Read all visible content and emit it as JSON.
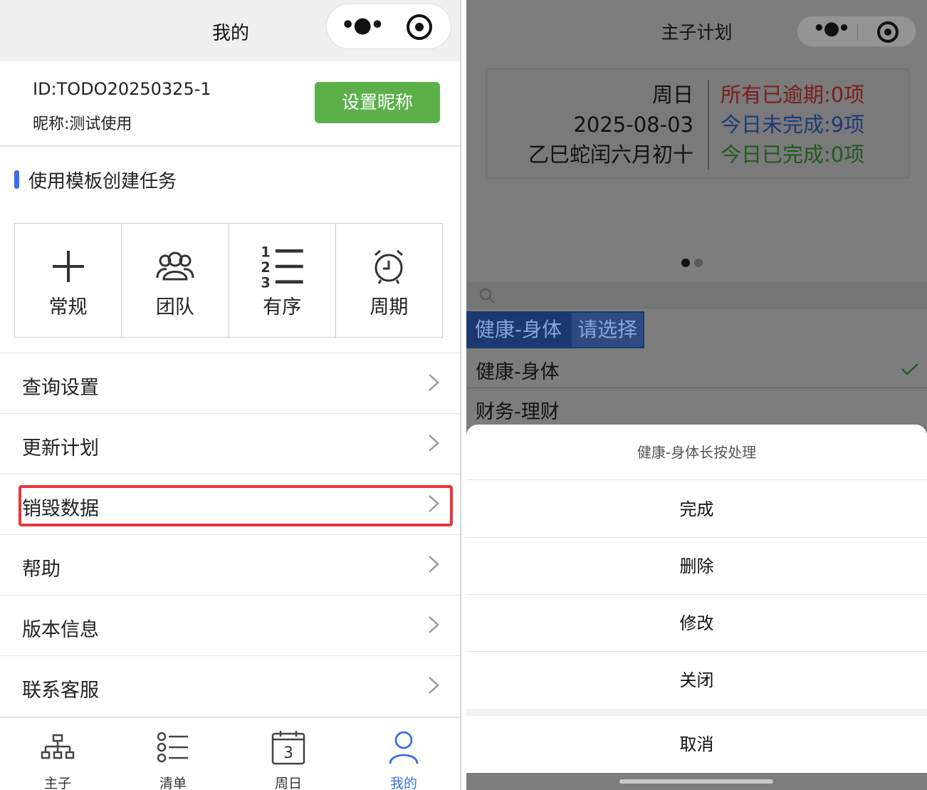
{
  "left": {
    "nav_title": "我的",
    "profile": {
      "uid": "ID:TODO20250325-1",
      "nickname": "昵称:测试使用",
      "set_nickname_button": "设置昵称"
    },
    "section_title": "使用模板创建任务",
    "templates": [
      {
        "label": "常规",
        "icon": "plus-icon"
      },
      {
        "label": "团队",
        "icon": "team-icon"
      },
      {
        "label": "有序",
        "icon": "ordered-list-icon"
      },
      {
        "label": "周期",
        "icon": "alarm-clock-icon"
      }
    ],
    "menu": [
      {
        "label": "查询设置"
      },
      {
        "label": "更新计划"
      },
      {
        "label": "销毁数据"
      },
      {
        "label": "帮助"
      },
      {
        "label": "版本信息"
      },
      {
        "label": "联系客服"
      }
    ],
    "tabs": [
      {
        "label": "主子",
        "icon": "hierarchy-icon"
      },
      {
        "label": "清单",
        "icon": "list-icon"
      },
      {
        "label": "周日",
        "icon": "calendar-icon",
        "day": "3"
      },
      {
        "label": "我的",
        "icon": "user-icon"
      }
    ],
    "active_tab": "我的",
    "highlight_color": "#e8363a",
    "accent_color": "#3b6fe8",
    "button_color": "#5cb04a"
  },
  "right": {
    "nav_title": "主子计划",
    "summary": {
      "weekday": "周日",
      "date": "2025-08-03",
      "lunar": "乙巳蛇闰六月初十",
      "overdue": "所有已逾期:0项",
      "today_incomplete": "今日未完成:9项",
      "today_complete": "今日已完成:0项"
    },
    "chips": {
      "selected": "健康-身体",
      "prompt": "请选择"
    },
    "options": [
      {
        "label": "健康-身体",
        "checked": true
      },
      {
        "label": "财务-理财",
        "checked": false
      }
    ],
    "action_sheet": {
      "title": "健康-身体长按处理",
      "actions": [
        "完成",
        "删除",
        "修改",
        "关闭"
      ],
      "cancel": "取消"
    }
  }
}
